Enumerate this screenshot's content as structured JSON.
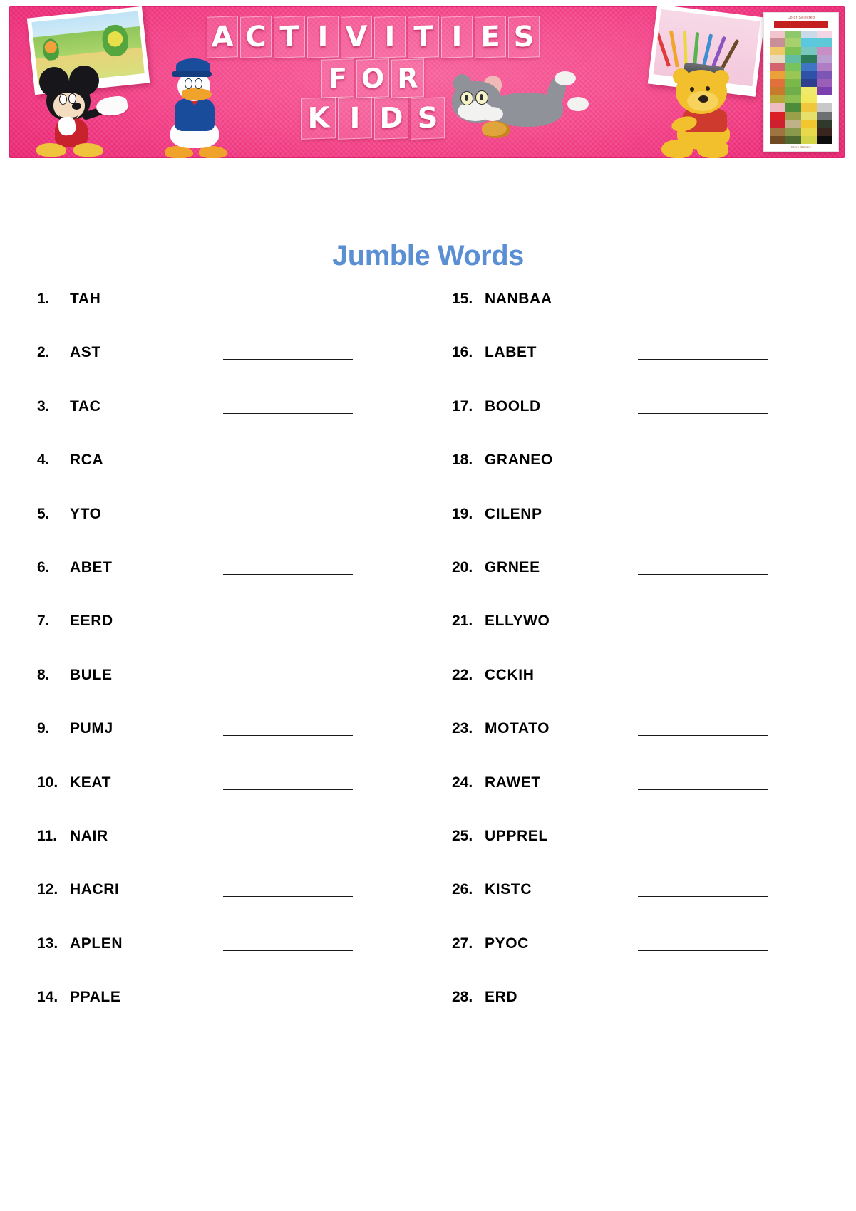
{
  "banner": {
    "title_lines": [
      "ACTIVITIES",
      "FOR",
      "KIDS"
    ],
    "colors": {
      "pink_light": "#f7609b",
      "pink_mid": "#f3468a",
      "pink_deep": "#e8206f"
    },
    "photo_left_alt": "children coloring picture",
    "photo_right_alt": "colored pencils in cup",
    "characters": [
      "mickey-mouse",
      "donald-duck",
      "tom-cat",
      "winnie-the-pooh"
    ],
    "palette": {
      "label_top": "Color Selected",
      "label_bottom": "More Colors",
      "selected_color": "#c42020",
      "swatches": [
        "#f2c5ce",
        "#8dc96b",
        "#c9dbe9",
        "#f3d6e6",
        "#c88f99",
        "#a8d06d",
        "#5bc8e0",
        "#5cc9d6",
        "#f0c96a",
        "#7dc255",
        "#79c8c0",
        "#c98fc4",
        "#e8dcc0",
        "#63bda0",
        "#2c7c5a",
        "#bb9ed0",
        "#d4646e",
        "#77c45c",
        "#3f76c4",
        "#b07cc4",
        "#eba13a",
        "#9ac653",
        "#2f52a8",
        "#7c56b5",
        "#e2703c",
        "#7bb84a",
        "#2f3f8f",
        "#9a5fb8",
        "#c77a2c",
        "#6fae48",
        "#f0ea6a",
        "#7b3fb0",
        "#b8a83a",
        "#8cbf52",
        "#f2e85e",
        "#ffffff",
        "#f0bcc4",
        "#4d8c3a",
        "#f0c63c",
        "#c8c8c8",
        "#dc1f26",
        "#9aa04a",
        "#e6e06a",
        "#6d7072",
        "#cf2030",
        "#c0b288",
        "#f2c62e",
        "#2f3a2c",
        "#a07440",
        "#8a9a4c",
        "#e8d84a",
        "#3a2420",
        "#6f4a22",
        "#4e6a32",
        "#d4d44a",
        "#0d0d0d"
      ]
    }
  },
  "worksheet": {
    "title": "Jumble Words",
    "columns": [
      {
        "name": "left",
        "items": [
          {
            "num": "1.",
            "word": "TAH"
          },
          {
            "num": "2.",
            "word": "AST"
          },
          {
            "num": "3.",
            "word": "TAC"
          },
          {
            "num": "4.",
            "word": "RCA"
          },
          {
            "num": "5.",
            "word": "YTO"
          },
          {
            "num": "6.",
            "word": "ABET"
          },
          {
            "num": "7.",
            "word": "EERD"
          },
          {
            "num": "8.",
            "word": "BULE"
          },
          {
            "num": "9.",
            "word": "PUMJ"
          },
          {
            "num": "10.",
            "word": "KEAT"
          },
          {
            "num": "11.",
            "word": "NAIR"
          },
          {
            "num": "12.",
            "word": "HACRI"
          },
          {
            "num": "13.",
            "word": "APLEN"
          },
          {
            "num": "14.",
            "word": "PPALE"
          }
        ]
      },
      {
        "name": "right",
        "items": [
          {
            "num": "15.",
            "word": "NANBAA"
          },
          {
            "num": "16.",
            "word": "LABET"
          },
          {
            "num": "17.",
            "word": "BOOLD"
          },
          {
            "num": "18.",
            "word": "GRANEO"
          },
          {
            "num": "19.",
            "word": "CILENP"
          },
          {
            "num": "20.",
            "word": "GRNEE"
          },
          {
            "num": "21.",
            "word": "ELLYWO"
          },
          {
            "num": "22.",
            "word": "CCKIH"
          },
          {
            "num": "23.",
            "word": "MOTATO"
          },
          {
            "num": "24.",
            "word": "RAWET"
          },
          {
            "num": "25.",
            "word": "UPPREL"
          },
          {
            "num": "26.",
            "word": "KISTC"
          },
          {
            "num": "27.",
            "word": "PYOC"
          },
          {
            "num": "28.",
            "word": "ERD"
          }
        ]
      }
    ]
  }
}
